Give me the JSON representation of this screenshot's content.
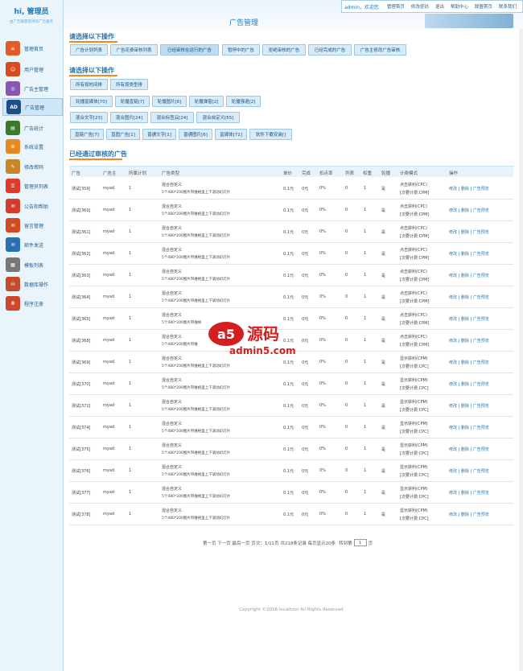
{
  "sidebar": {
    "hello": "hi, 管理员",
    "subtitle": "由广告联盟提供的广告服务",
    "items": [
      {
        "label": "管理首页",
        "icon": "home-icon",
        "color": "#e05a2a"
      },
      {
        "label": "用户管理",
        "icon": "users-icon",
        "color": "#d84a1f"
      },
      {
        "label": "广告主管理",
        "icon": "advertiser-icon",
        "color": "#8a56b3"
      },
      {
        "label": "广告管理",
        "icon": "ad-icon",
        "color": "#1c4f8a"
      },
      {
        "label": "广告统计",
        "icon": "stats-icon",
        "color": "#3b7a2d"
      },
      {
        "label": "系统设置",
        "icon": "settings-icon",
        "color": "#e68a1f"
      },
      {
        "label": "修改密码",
        "icon": "password-icon",
        "color": "#c8862a"
      },
      {
        "label": "管理员列表",
        "icon": "admin-list-icon",
        "color": "#e03b2a"
      },
      {
        "label": "公告和帮助",
        "icon": "notice-icon",
        "color": "#d43b2a"
      },
      {
        "label": "留言管理",
        "icon": "message-icon",
        "color": "#d44a20"
      },
      {
        "label": "邮件发送",
        "icon": "mail-icon",
        "color": "#2a6fb3"
      },
      {
        "label": "模板列表",
        "icon": "template-icon",
        "color": "#777777"
      },
      {
        "label": "数据库操作",
        "icon": "database-icon",
        "color": "#c54a2a"
      },
      {
        "label": "程序注册",
        "icon": "register-icon",
        "color": "#d0462a"
      }
    ]
  },
  "topbar": {
    "title": "广告管理",
    "user": "admin，欢迎您",
    "links": [
      "管理首页",
      "修改密码",
      "退出",
      "帮助中心",
      "联盟首页",
      "联系我们"
    ]
  },
  "section1": {
    "title": "请选择以下操作",
    "buttons": [
      "广告计划列表",
      "广告花费审核列表",
      "已经审核在运行的广告",
      "暂停中的广告",
      "拒绝审核的广告",
      "已经完成的广告",
      "广告主修改广告审核"
    ]
  },
  "section2": {
    "title": "请选择以下操作",
    "row1": [
      "所有按时间排",
      "所有按类型排"
    ],
    "row2": [
      "轮播富媒体[70]",
      "轮播直链[7]",
      "轮播图片[6]",
      "轮播弹窗[2]",
      "轮播强退[2]"
    ],
    "row3": [
      "混合文字[23]",
      "混合图片[24]",
      "混合标签云[24]",
      "混合自定义[55]"
    ],
    "row4": [
      "直链广告[7]",
      "直图广告[1]",
      "普通文字[1]",
      "普通图片[6]",
      "富媒体[71]",
      "软件下载安装[]"
    ]
  },
  "section3": {
    "title": "已经通过审核的广告"
  },
  "table": {
    "headers": [
      "广告",
      "广告主",
      "所属计划",
      "广告类型",
      "单价",
      "完成",
      "扣点率",
      "列表",
      "权重",
      "轮播",
      "计费模式",
      "操作"
    ],
    "rows": [
      {
        "name": "测试[359]",
        "adv": "myad",
        "plan": "1",
        "type1": "混合自定义",
        "type2": "5个480*200图片带维格里上下滚动幻灯片",
        "price": "0.1元",
        "done": "0元",
        "rate": "0%",
        "list": "0",
        "weight": "1",
        "rot": "是",
        "bill1": "点击获利(CPC)",
        "bill2": "[次要计费:CPM]",
        "op1": "修改",
        "op2": "删除",
        "op3": "广告预览"
      },
      {
        "name": "测试[360]",
        "adv": "myad",
        "plan": "1",
        "type1": "混合自定义",
        "type2": "5个480*200图片带维格里上下滚动幻灯片",
        "price": "0.1元",
        "done": "0元",
        "rate": "0%",
        "list": "0",
        "weight": "1",
        "rot": "是",
        "bill1": "点击获利(CPC)",
        "bill2": "[次要计费:CPM]",
        "op1": "修改",
        "op2": "删除",
        "op3": "广告预览"
      },
      {
        "name": "测试[361]",
        "adv": "myad",
        "plan": "1",
        "type1": "混合自定义",
        "type2": "5个480*200图片带维格里上下滚动幻灯片",
        "price": "0.1元",
        "done": "0元",
        "rate": "0%",
        "list": "0",
        "weight": "1",
        "rot": "是",
        "bill1": "点击获利(CPC)",
        "bill2": "[次要计费:CPM]",
        "op1": "修改",
        "op2": "删除",
        "op3": "广告预览"
      },
      {
        "name": "测试[362]",
        "adv": "myad",
        "plan": "1",
        "type1": "混合自定义",
        "type2": "5个480*200图片带维格里上下滚动幻灯片",
        "price": "0.1元",
        "done": "0元",
        "rate": "0%",
        "list": "0",
        "weight": "1",
        "rot": "是",
        "bill1": "点击获利(CPC)",
        "bill2": "[次要计费:CPM]",
        "op1": "修改",
        "op2": "删除",
        "op3": "广告预览"
      },
      {
        "name": "测试[363]",
        "adv": "myad",
        "plan": "1",
        "type1": "混合自定义",
        "type2": "5个480*200图片带维格里上下滚动幻灯片",
        "price": "0.1元",
        "done": "0元",
        "rate": "0%",
        "list": "0",
        "weight": "1",
        "rot": "是",
        "bill1": "点击获利(CPC)",
        "bill2": "[次要计费:CPM]",
        "op1": "修改",
        "op2": "删除",
        "op3": "广告预览"
      },
      {
        "name": "测试[364]",
        "adv": "myad",
        "plan": "1",
        "type1": "混合自定义",
        "type2": "5个480*200图片带维格里上下滚动幻灯片",
        "price": "0.1元",
        "done": "0元",
        "rate": "0%",
        "list": "0",
        "weight": "1",
        "rot": "是",
        "bill1": "点击获利(CPC)",
        "bill2": "[次要计费:CPM]",
        "op1": "修改",
        "op2": "删除",
        "op3": "广告预览"
      },
      {
        "name": "测试[365]",
        "adv": "myad",
        "plan": "1",
        "type1": "混合自定义",
        "type2": "5个480*200图片带维格",
        "price": "0.1元",
        "done": "0元",
        "rate": "0%",
        "list": "0",
        "weight": "1",
        "rot": "是",
        "bill1": "点击获利(CPC)",
        "bill2": "[次要计费:CPM]",
        "op1": "修改",
        "op2": "删除",
        "op3": "广告预览"
      },
      {
        "name": "测试[368]",
        "adv": "myad",
        "plan": "1",
        "type1": "混合自定义",
        "type2": "5个480*200图片带维",
        "price": "0.1元",
        "done": "0元",
        "rate": "0%",
        "list": "0",
        "weight": "1",
        "rot": "是",
        "bill1": "点击获利(CPC)",
        "bill2": "[次要计费:CPM]",
        "op1": "修改",
        "op2": "删除",
        "op3": "广告预览"
      },
      {
        "name": "测试[369]",
        "adv": "myad",
        "plan": "1",
        "type1": "混合自定义",
        "type2": "5个480*200图片带维格里上下滚动幻灯片",
        "price": "0.1元",
        "done": "0元",
        "rate": "0%",
        "list": "0",
        "weight": "1",
        "rot": "是",
        "bill1": "显示获利(CPM)",
        "bill2": "[次要计费:CPC]",
        "op1": "修改",
        "op2": "删除",
        "op3": "广告预览"
      },
      {
        "name": "测试[370]",
        "adv": "myad",
        "plan": "1",
        "type1": "混合自定义",
        "type2": "5个480*200图片带维格里上下滚动幻灯片",
        "price": "0.1元",
        "done": "0元",
        "rate": "0%",
        "list": "0",
        "weight": "1",
        "rot": "是",
        "bill1": "显示获利(CPM)",
        "bill2": "[次要计费:CPC]",
        "op1": "修改",
        "op2": "删除",
        "op3": "广告预览"
      },
      {
        "name": "测试[371]",
        "adv": "myad",
        "plan": "1",
        "type1": "混合自定义",
        "type2": "5个480*200图片带维格里上下滚动幻灯片",
        "price": "0.1元",
        "done": "0元",
        "rate": "0%",
        "list": "0",
        "weight": "1",
        "rot": "是",
        "bill1": "显示获利(CPM)",
        "bill2": "[次要计费:CPC]",
        "op1": "修改",
        "op2": "删除",
        "op3": "广告预览"
      },
      {
        "name": "测试[374]",
        "adv": "myad",
        "plan": "1",
        "type1": "混合自定义",
        "type2": "5个480*200图片带维格里上下滚动幻灯片",
        "price": "0.1元",
        "done": "0元",
        "rate": "0%",
        "list": "0",
        "weight": "1",
        "rot": "是",
        "bill1": "显示获利(CPM)",
        "bill2": "[次要计费:CPC]",
        "op1": "修改",
        "op2": "删除",
        "op3": "广告预览"
      },
      {
        "name": "测试[375]",
        "adv": "myad",
        "plan": "1",
        "type1": "混合自定义",
        "type2": "5个480*200图片带维格里上下滚动幻灯片",
        "price": "0.1元",
        "done": "0元",
        "rate": "0%",
        "list": "0",
        "weight": "1",
        "rot": "是",
        "bill1": "显示获利(CPM)",
        "bill2": "[次要计费:CPC]",
        "op1": "修改",
        "op2": "删除",
        "op3": "广告预览"
      },
      {
        "name": "测试[376]",
        "adv": "myad",
        "plan": "1",
        "type1": "混合自定义",
        "type2": "5个480*200图片带维格里上下滚动幻灯片",
        "price": "0.1元",
        "done": "0元",
        "rate": "0%",
        "list": "0",
        "weight": "1",
        "rot": "是",
        "bill1": "显示获利(CPM)",
        "bill2": "[次要计费:CPC]",
        "op1": "修改",
        "op2": "删除",
        "op3": "广告预览"
      },
      {
        "name": "测试[377]",
        "adv": "myad",
        "plan": "1",
        "type1": "混合自定义",
        "type2": "5个480*200图片带维格里上下滚动幻灯片",
        "price": "0.1元",
        "done": "0元",
        "rate": "0%",
        "list": "0",
        "weight": "1",
        "rot": "是",
        "bill1": "显示获利(CPM)",
        "bill2": "[次要计费:CPC]",
        "op1": "修改",
        "op2": "删除",
        "op3": "广告预览"
      },
      {
        "name": "测试[378]",
        "adv": "myad",
        "plan": "1",
        "type1": "混合自定义",
        "type2": "5个480*200图片带维格里上下滚动幻灯片",
        "price": "0.1元",
        "done": "0元",
        "rate": "0%",
        "list": "0",
        "weight": "1",
        "rot": "是",
        "bill1": "显示获利(CPM)",
        "bill2": "[次要计费:CPC]",
        "op1": "修改",
        "op2": "删除",
        "op3": "广告预览"
      }
    ]
  },
  "pager": {
    "text": "第一页 下一页 最后一页 页次：1/11页 共218条记录 每页显示20条",
    "jump_label": "转到第",
    "page_value": "1",
    "page_suffix": "页"
  },
  "footer": {
    "text": "Copyright ©2016 localhost All Rights Reserved"
  },
  "watermark": {
    "brand": "a5源码",
    "url": "admin5.com"
  },
  "colors": {
    "accent": "#2874b0",
    "underline": "#ef8a1e",
    "button_bg": "#d8ebf8"
  }
}
